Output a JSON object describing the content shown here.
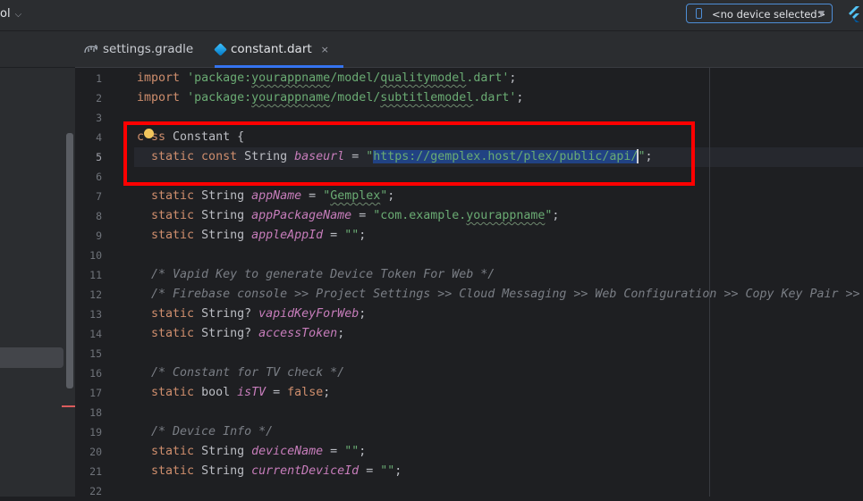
{
  "toolbar": {
    "project_fragment": "ol",
    "device_selector": "<no device selected>"
  },
  "tabs": [
    {
      "label": "settings.gradle",
      "icon": "gradle-icon",
      "active": false
    },
    {
      "label": "constant.dart",
      "icon": "dart-icon",
      "active": true,
      "close": "×"
    }
  ],
  "editor": {
    "current_line": 5,
    "line_numbers": [
      "1",
      "2",
      "3",
      "4",
      "5",
      "6",
      "7",
      "8",
      "9",
      "10",
      "11",
      "12",
      "13",
      "14",
      "15",
      "16",
      "17",
      "18",
      "19",
      "20",
      "21",
      "22"
    ],
    "code": {
      "l1": {
        "kw": "import",
        "str": "'package:",
        "ul": "yourappname",
        "mid": "/model/",
        "ul2": "qualitymodel",
        "end": ".dart'",
        "punct": ";"
      },
      "l2": {
        "kw": "import",
        "str": "'package:",
        "ul": "yourappname",
        "mid": "/model/",
        "ul2": "subtitlemodel",
        "end": ".dart'",
        "punct": ";"
      },
      "l4": {
        "kw_a": "c",
        "kw_b": "ss",
        "rest": " Constant {"
      },
      "l5": {
        "kw": "static const",
        "type": " String ",
        "field": "baseurl",
        "eq": " = ",
        "q1": "\"",
        "url": "https://gemplex.host/plex/public/api/",
        "q2": "\"",
        "punct": ";"
      },
      "l7": {
        "kw": "static",
        "type": " String ",
        "field": "appName",
        "eq": " = ",
        "str": "\"",
        "ul": "Gemplex",
        "str2": "\"",
        "punct": ";"
      },
      "l8": {
        "kw": "static",
        "type": " String ",
        "field": "appPackageName",
        "eq": " = ",
        "str": "\"com.example.",
        "ul": "yourappname",
        "str2": "\"",
        "punct": ";"
      },
      "l9": {
        "kw": "static",
        "type": " String ",
        "field": "appleAppId",
        "eq": " = ",
        "str": "\"\"",
        "punct": ";"
      },
      "l11": {
        "cmt": "/* Vapid Key to generate Device Token For Web */"
      },
      "l12": {
        "cmt": "/* Firebase console >> Project Settings >> Cloud Messaging >> Web Configuration >> Copy Key Pair >>"
      },
      "l13": {
        "kw": "static",
        "type": " String? ",
        "field": "vapidKeyForWeb",
        "punct": ";"
      },
      "l14": {
        "kw": "static",
        "type": " String? ",
        "field": "accessToken",
        "punct": ";"
      },
      "l16": {
        "cmt": "/* Constant for TV check */"
      },
      "l17": {
        "kw": "static",
        "type": " bool ",
        "field": "isTV",
        "eq": " = ",
        "kw2": "false",
        "punct": ";"
      },
      "l19": {
        "cmt": "/* Device Info */"
      },
      "l20": {
        "kw": "static",
        "type": " String ",
        "field": "deviceName",
        "eq": " = ",
        "str": "\"\"",
        "punct": ";"
      },
      "l21": {
        "kw": "static",
        "type": " String ",
        "field": "currentDeviceId",
        "eq": " = ",
        "str": "\"\"",
        "punct": ";"
      }
    }
  },
  "colors": {
    "keyword": "#cf8e6d",
    "string": "#6aab73",
    "field": "#c77dbb",
    "comment": "#7a7e85",
    "annotation_box": "#ff0000",
    "selection": "#214283",
    "active_tab_underline": "#3574f0"
  }
}
